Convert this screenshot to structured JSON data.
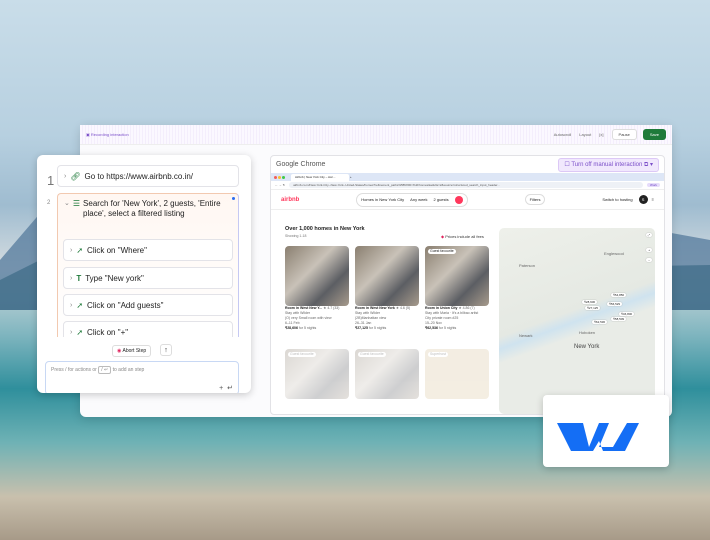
{
  "header": {
    "title": "Recording interaction",
    "autoscroll": "Autoscroll",
    "layout": "Layout",
    "variables": "[x]",
    "pause": "Pause",
    "save": "Save"
  },
  "steps": {
    "items": [
      {
        "number": "1",
        "label": "Go to https://www.airbnb.co.in/"
      },
      {
        "number": "2",
        "label": "Search for 'New York', 2 guests, 'Entire place', select a filtered listing"
      }
    ],
    "substeps": [
      {
        "icon": "cursor-click-icon",
        "label": "Click on \"Where\""
      },
      {
        "icon": "text-type-icon",
        "label": "Type \"New york\""
      },
      {
        "icon": "cursor-click-icon",
        "label": "Click on \"Add guests\""
      },
      {
        "icon": "cursor-click-icon",
        "label": "Click on \"+\""
      }
    ],
    "abort": "Abort Step",
    "input_prefix": "Press / for actions or",
    "input_key": "/ ↵",
    "input_suffix": "to add an step"
  },
  "browser": {
    "app": "Google Chrome",
    "turn_off": "Turn off manual interaction",
    "tab": "Airbnb | New York City – Acc...",
    "url": "airbnb.co.in/New-York-City--New-York--United-States/homes?refinement_paths%5B%5D=%2Fhomes&adults=2&source=structured_search_input_header...",
    "profile": "Work",
    "airbnb": {
      "logo": "airbnb",
      "where": "Homes in New York City",
      "when": "Any week",
      "who": "2 guests",
      "filters": "Filters",
      "host": "Switch to hosting",
      "avatar": "S",
      "heading": "Over 1,000 homes in New York",
      "showing": "Showing 1-18",
      "prices": "Prices include all fees",
      "listings": [
        {
          "title": "Room in West New Y...",
          "rating": "★ 4.7 (33)",
          "host": "Stay with Wilder",
          "desc": "(O) very Small room with view",
          "dates": "6–11 Feb",
          "price": "₹28,606",
          "price_note": "for 5 nights",
          "badge": ""
        },
        {
          "title": "Room in West New York",
          "rating": "★ 4.6 (5)",
          "host": "Stay with Wilder",
          "desc": "(2B)Manhattan view",
          "dates": "26–31 Jan",
          "price": "₹27,125",
          "price_note": "for 5 nights",
          "badge": ""
        },
        {
          "title": "Room in Union City",
          "rating": "★ 4.86 (7)",
          "host": "Stay with Maria · It's a bilbao artist",
          "desc": "City private room #25",
          "dates": "15–20 Nov",
          "price": "₹62,536",
          "price_note": "for 5 nights",
          "badge": "Guest favourite"
        }
      ],
      "faded_badges": [
        "Guest favourite",
        "Guest favourite",
        "Superhost"
      ],
      "map": {
        "city": "New York",
        "places": [
          "Newark",
          "Hoboken",
          "Paterson",
          "Englewood"
        ],
        "pins": [
          "₹54,856",
          "₹56,529",
          "₹28,606",
          "₹27,125",
          "₹46,800",
          "₹58,509",
          "₹62,536"
        ]
      }
    }
  }
}
